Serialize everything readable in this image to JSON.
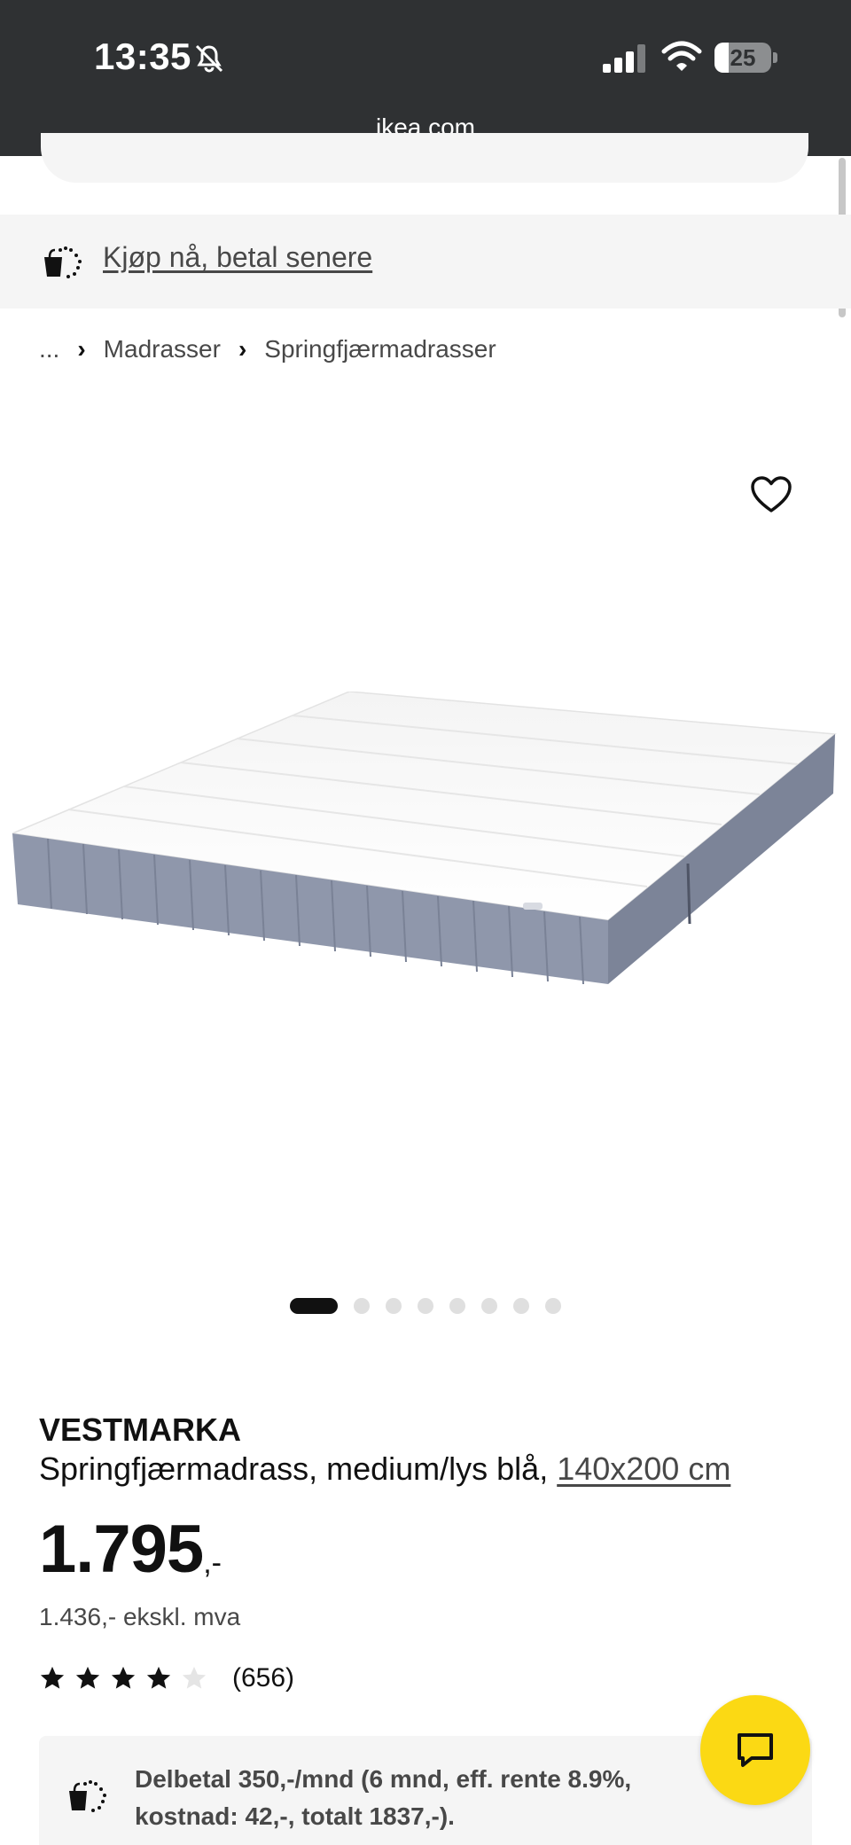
{
  "status_bar": {
    "time": "13:35",
    "battery_level": "25",
    "icons": [
      "bell-slash-icon",
      "cellular-signal-icon",
      "wifi-icon",
      "battery-icon"
    ]
  },
  "browser": {
    "url": "ikea.com"
  },
  "pay_later": {
    "label": "Kjøp nå, betal senere",
    "icon": "shopping-bag-dotted-icon"
  },
  "breadcrumb": {
    "items": [
      "...",
      "Madrasser",
      "Springfjærmadrasser"
    ]
  },
  "gallery": {
    "image_count": 8,
    "active_index": 0,
    "favorite_icon": "heart-outline-icon"
  },
  "product": {
    "brand": "VESTMARKA",
    "description": "Springfjærmadrass, medium/lys blå, ",
    "size_link": "140x200 cm",
    "price_main": "1.795",
    "price_suffix": ",-",
    "price_ex_vat": "1.436,- ekskl. mva",
    "rating_value": 4,
    "rating_max": 5,
    "rating_count": "(656)"
  },
  "installment": {
    "text": "Delbetal 350,-/mnd (6 mnd, eff. rente 8.9%, kostnad: 42,-, totalt 1837,-).",
    "icon": "shopping-bag-dotted-icon"
  },
  "chat": {
    "icon": "chat-bubble-icon"
  },
  "colors": {
    "status_bar_bg": "#2f3133",
    "banner_bg": "#f5f5f5",
    "accent_yellow": "#fbd914",
    "text_primary": "#111111",
    "text_secondary": "#484848",
    "mattress_blue": "#8f97ab"
  }
}
